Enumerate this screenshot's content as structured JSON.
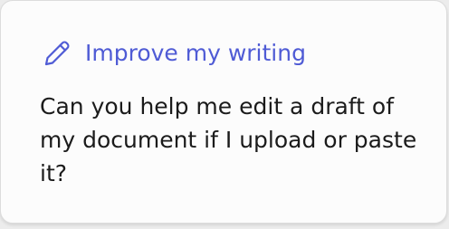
{
  "card": {
    "icon": "pencil-icon",
    "title": "Improve my writing",
    "body": "Can you help me edit a draft of my document if I upload or paste it?",
    "accent_color": "#4f5bd5"
  }
}
